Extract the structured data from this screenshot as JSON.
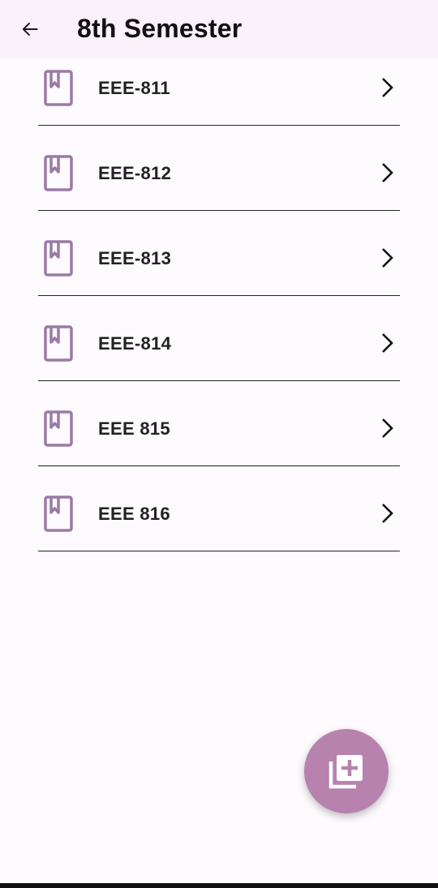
{
  "header": {
    "title": "8th Semester",
    "back_icon": "arrow-back-icon"
  },
  "courses": [
    {
      "label": "EEE-811"
    },
    {
      "label": "EEE-812"
    },
    {
      "label": "EEE-813"
    },
    {
      "label": "EEE-814"
    },
    {
      "label": "EEE 815"
    },
    {
      "label": "EEE 816"
    }
  ],
  "fab": {
    "icon": "library-add-icon"
  },
  "colors": {
    "app_bar_bg": "#fbf1fb",
    "book_icon": "#9a7aa6",
    "fab_bg": "#b782ae"
  }
}
